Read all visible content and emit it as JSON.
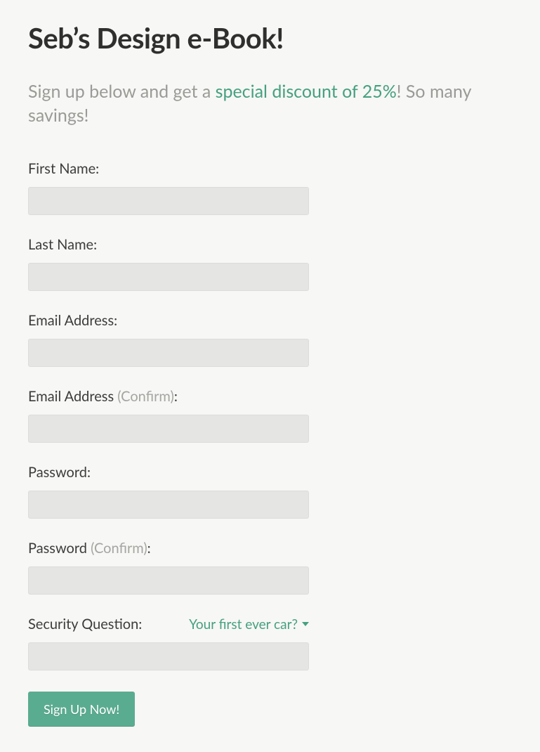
{
  "heading": "Seb’s Design e-Book!",
  "subheading_before": "Sign up below and get a ",
  "subheading_highlight": "special discount of 25%",
  "subheading_after": "! So many savings!",
  "confirm_text": "(Confirm)",
  "colon": ":",
  "fields": {
    "first_name": {
      "label": "First Name:",
      "value": ""
    },
    "last_name": {
      "label": "Last Name:",
      "value": ""
    },
    "email": {
      "label": "Email Address:",
      "value": ""
    },
    "email_confirm": {
      "label_prefix": "Email Address ",
      "value": ""
    },
    "password": {
      "label": "Password:",
      "value": ""
    },
    "password_confirm": {
      "label_prefix": "Password ",
      "value": ""
    },
    "security": {
      "label": "Security Question:",
      "selected": "Your first ever car?",
      "value": ""
    }
  },
  "submit_label": "Sign Up Now!",
  "accent_color": "#45a081"
}
